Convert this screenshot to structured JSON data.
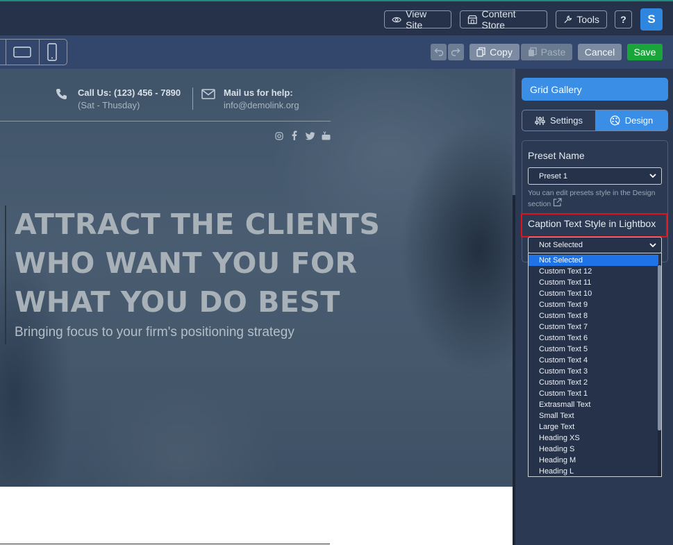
{
  "topbar": {
    "view_site": "View Site",
    "content_store": "Content Store",
    "tools": "Tools",
    "help": "?",
    "avatar_initial": "S"
  },
  "toolbar": {
    "copy": "Copy",
    "paste": "Paste",
    "cancel": "Cancel",
    "save": "Save"
  },
  "hero": {
    "call_label": "Call Us: (123) 456 - 7890",
    "call_hours": "(Sat - Thusday)",
    "mail_label": "Mail us for help:",
    "mail_address": "info@demolink.org",
    "headline_1": "ATTRACT THE CLIENTS",
    "headline_2": "WHO WANT YOU FOR",
    "headline_3": "WHAT YOU DO BEST",
    "subheadline": "Bringing focus to your firm's positioning strategy"
  },
  "panel": {
    "title": "Grid Gallery",
    "tabs": [
      {
        "label": "Settings"
      },
      {
        "label": "Design"
      }
    ],
    "preset_name_label": "Preset Name",
    "preset_value": "Preset 1",
    "preset_help": "You can edit presets style in the Design section",
    "caption_label": "Caption Text Style in Lightbox",
    "caption_value": "Not Selected",
    "options": [
      "Not Selected",
      "Custom Text 12",
      "Custom Text 11",
      "Custom Text 10",
      "Custom Text 9",
      "Custom Text 8",
      "Custom Text 7",
      "Custom Text 6",
      "Custom Text 5",
      "Custom Text 4",
      "Custom Text 3",
      "Custom Text 2",
      "Custom Text 1",
      "Extrasmall Text",
      "Small Text",
      "Large Text",
      "Heading XS",
      "Heading S",
      "Heading M",
      "Heading L"
    ]
  },
  "colors": {
    "accent": "#3a8ee6",
    "save": "#1aa53a",
    "highlight": "#e0121c",
    "selected_option": "#1f73e6"
  }
}
